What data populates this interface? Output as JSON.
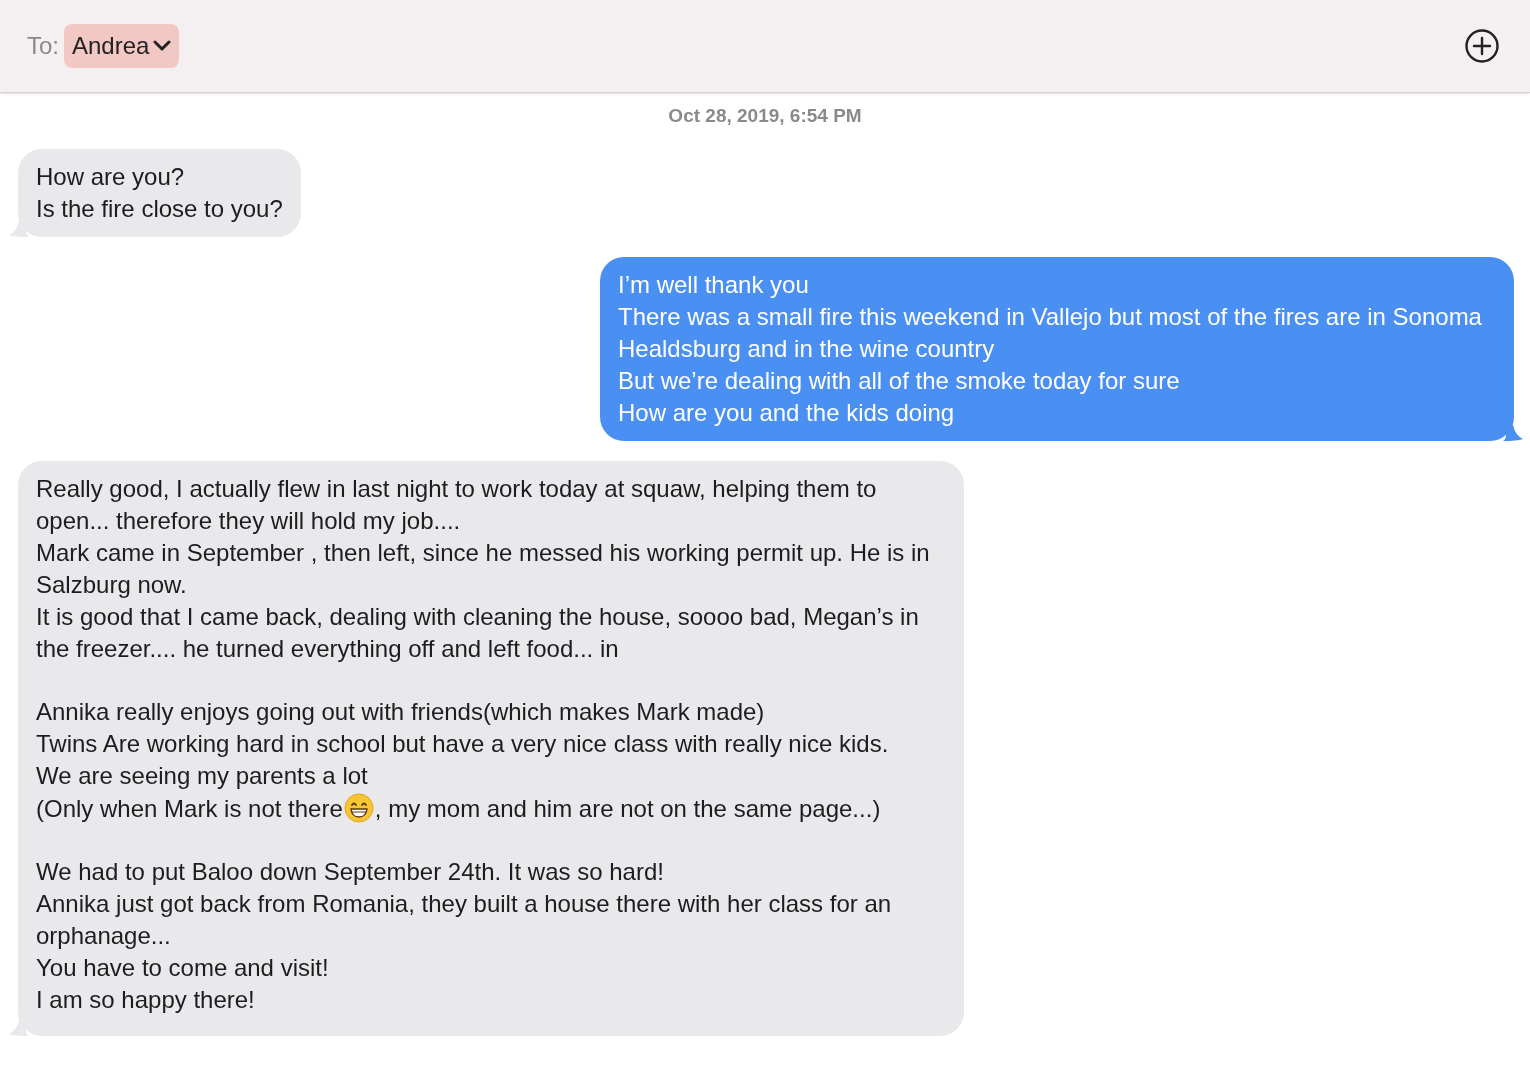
{
  "header": {
    "to_label": "To:",
    "recipient": "Andrea"
  },
  "timestamp": "Oct 28, 2019, 6:54 PM",
  "messages": [
    {
      "kind": "received",
      "lines": [
        {
          "kind": "text",
          "text": "How are you?"
        },
        {
          "kind": "text",
          "text": "Is the fire close to you?"
        }
      ]
    },
    {
      "kind": "sent",
      "lines": [
        {
          "kind": "text",
          "text": "I’m well thank you"
        },
        {
          "kind": "text",
          "text": "There was a small fire this weekend in Vallejo but most of the fires are in Sonoma Healdsburg and in the wine country"
        },
        {
          "kind": "text",
          "text": "But we’re dealing with all of the smoke today for sure"
        },
        {
          "kind": "text",
          "text": "How are you and the kids doing"
        }
      ]
    },
    {
      "kind": "received",
      "lines": [
        {
          "kind": "text",
          "text": "Really good, I actually flew in last night to work today at squaw, helping them to open... therefore they will hold my job...."
        },
        {
          "kind": "text",
          "text": "Mark came in September , then left, since he messed his working permit up. He is in Salzburg now."
        },
        {
          "kind": "text",
          "text": "It is good that I came back, dealing with cleaning the house, soooo bad, Megan’s in the freezer.... he turned everything off and left food... in"
        },
        {
          "kind": "blank"
        },
        {
          "kind": "text",
          "text": "Annika really enjoys going out with friends(which makes Mark made)"
        },
        {
          "kind": "text",
          "text": "Twins Are working hard in school but have a very nice class with really nice kids."
        },
        {
          "kind": "text",
          "text": "We are seeing my parents a lot"
        },
        {
          "kind": "mixed",
          "parts": [
            {
              "kind": "text",
              "text": "(Only when Mark is not there"
            },
            {
              "kind": "grin_emoji"
            },
            {
              "kind": "text",
              "text": ", my mom and him are not on the same page...)"
            }
          ]
        },
        {
          "kind": "blank"
        },
        {
          "kind": "text",
          "text": "We had to put Baloo down September 24th. It was so hard!"
        },
        {
          "kind": "text",
          "text": "Annika just got back from Romania, they built a house there with her class for an orphanage..."
        },
        {
          "kind": "text",
          "text": "You have to come and visit!"
        },
        {
          "kind": "text",
          "text": "I am so happy there!"
        }
      ]
    }
  ]
}
